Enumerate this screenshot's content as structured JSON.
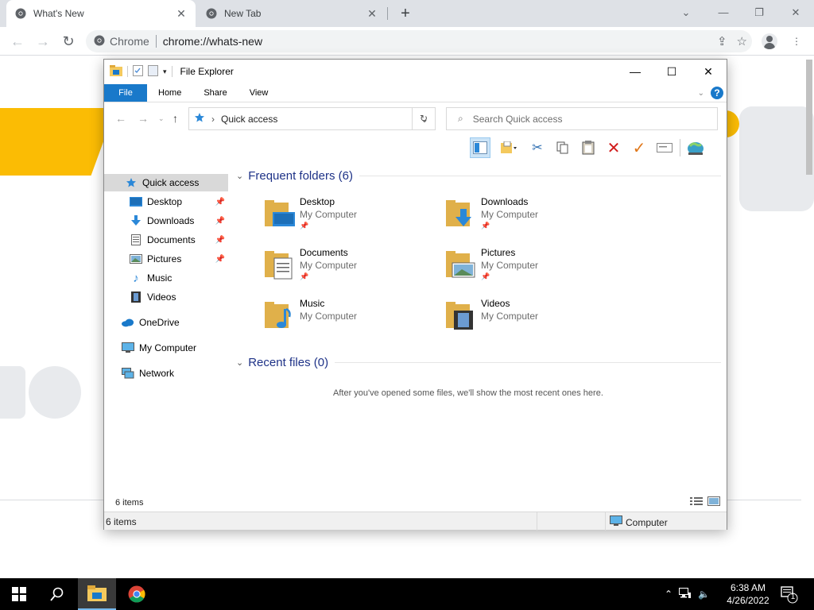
{
  "browser": {
    "tabs": [
      {
        "title": "What's New",
        "active": true
      },
      {
        "title": "New Tab",
        "active": false
      }
    ],
    "omnibox": {
      "chip": "Chrome",
      "url": "chrome://whats-new"
    }
  },
  "explorer": {
    "title": "File Explorer",
    "ribbon_tabs": [
      "File",
      "Home",
      "Share",
      "View"
    ],
    "address": "Quick access",
    "search_placeholder": "Search Quick access",
    "nav": [
      {
        "label": "Quick access",
        "icon": "star-icon",
        "pinned": false
      },
      {
        "label": "Desktop",
        "icon": "desktop-icon",
        "pinned": true
      },
      {
        "label": "Downloads",
        "icon": "download-icon",
        "pinned": true
      },
      {
        "label": "Documents",
        "icon": "document-icon",
        "pinned": true
      },
      {
        "label": "Pictures",
        "icon": "picture-icon",
        "pinned": true
      },
      {
        "label": "Music",
        "icon": "music-icon",
        "pinned": false
      },
      {
        "label": "Videos",
        "icon": "video-icon",
        "pinned": false
      },
      {
        "label": "OneDrive",
        "icon": "cloud-icon",
        "pinned": false
      },
      {
        "label": "My Computer",
        "icon": "computer-icon",
        "pinned": false
      },
      {
        "label": "Network",
        "icon": "network-icon",
        "pinned": false
      }
    ],
    "frequent_heading": "Frequent folders (6)",
    "folders": [
      {
        "name": "Desktop",
        "location": "My Computer",
        "pinned": true
      },
      {
        "name": "Downloads",
        "location": "My Computer",
        "pinned": true
      },
      {
        "name": "Documents",
        "location": "My Computer",
        "pinned": true
      },
      {
        "name": "Pictures",
        "location": "My Computer",
        "pinned": true
      },
      {
        "name": "Music",
        "location": "My Computer",
        "pinned": false
      },
      {
        "name": "Videos",
        "location": "My Computer",
        "pinned": false
      }
    ],
    "recent_heading": "Recent files (0)",
    "recent_empty": "After you've opened some files, we'll show the most recent ones here.",
    "status_items": "6 items",
    "status_items_lower": "6 items",
    "status_location": "Computer"
  },
  "taskbar": {
    "time": "6:38 AM",
    "date": "4/26/2022",
    "notification_count": "1"
  },
  "colors": {
    "accent": "#1979ca",
    "heading": "#1e3287",
    "folder": "#f4c95d"
  }
}
